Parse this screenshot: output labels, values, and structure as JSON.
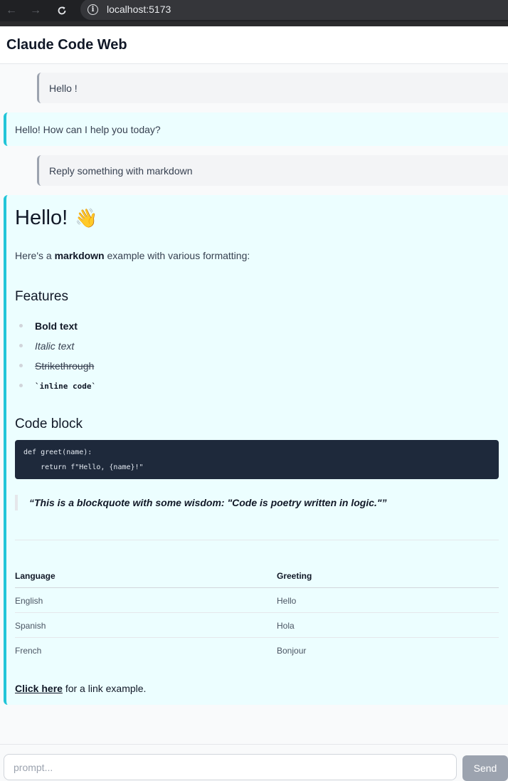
{
  "browser": {
    "url": "localhost:5173"
  },
  "header": {
    "title": "Claude Code Web"
  },
  "messages": {
    "user1": "Hello !",
    "bot1": "Hello! How can I help you today?",
    "user2": "Reply something with markdown",
    "bot2": {
      "heading": "Hello!",
      "emoji": "👋",
      "intro_prefix": "Here's a ",
      "intro_bold": "markdown",
      "intro_suffix": " example with various formatting:",
      "features_heading": "Features",
      "features": {
        "bold": "Bold text",
        "italic": "Italic text",
        "strike": "Strikethrough",
        "code": "`inline code`"
      },
      "code_heading": "Code block",
      "code_lines": [
        "def greet(name):",
        "    return f\"Hello, {name}!\""
      ],
      "blockquote": "“This is a blockquote with some wisdom: \"Code is poetry written in logic.\"”",
      "table": {
        "headers": [
          "Language",
          "Greeting"
        ],
        "rows": [
          [
            "English",
            "Hello"
          ],
          [
            "Spanish",
            "Hola"
          ],
          [
            "French",
            "Bonjour"
          ]
        ]
      },
      "link_text": "Click here",
      "link_suffix": " for a link example."
    }
  },
  "input": {
    "placeholder": "prompt...",
    "send_label": "Send"
  }
}
